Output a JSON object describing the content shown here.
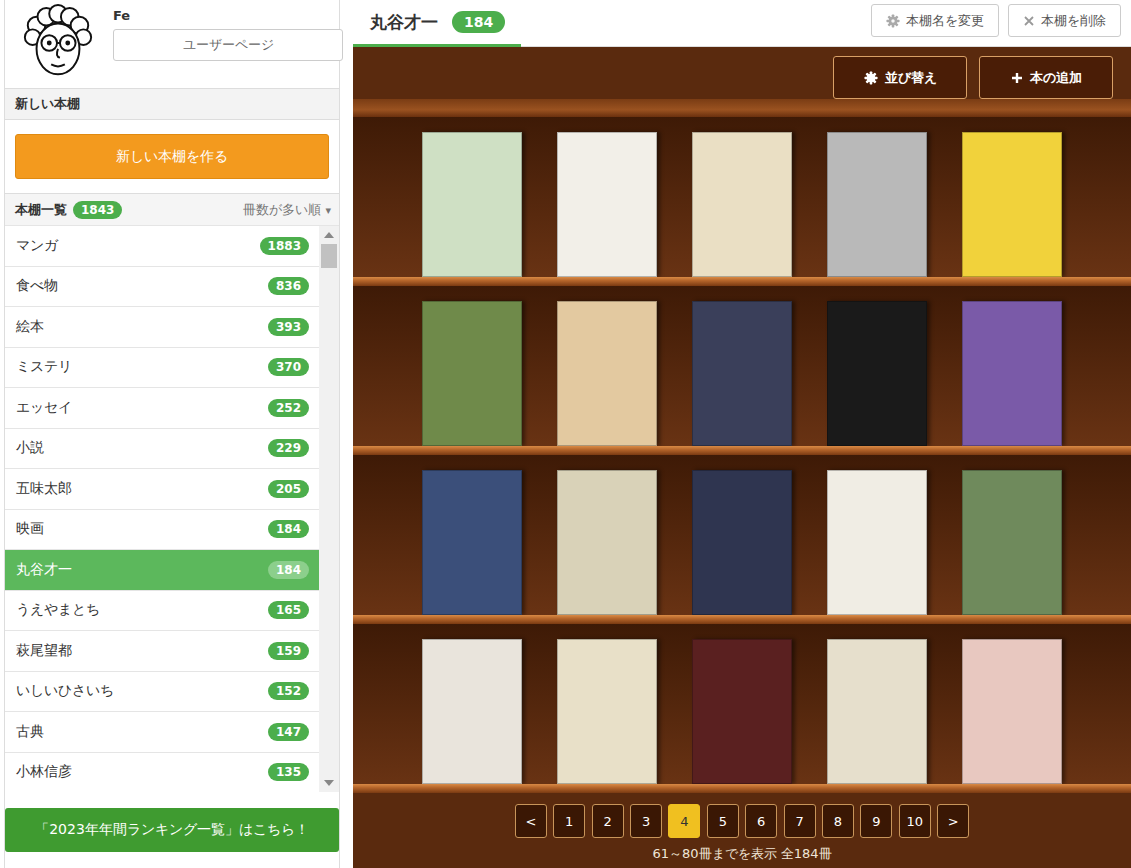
{
  "user": {
    "name": "Fe",
    "page_button": "ユーザーページ"
  },
  "new_shelf": {
    "heading": "新しい本棚",
    "button": "新しい本棚を作る"
  },
  "shelf_list": {
    "heading": "本棚一覧",
    "count": "1843",
    "sort": "冊数が多い順",
    "sort_icon": "▾",
    "items": [
      {
        "name": "マンガ",
        "count": "1883",
        "selected": false
      },
      {
        "name": "食べ物",
        "count": "836",
        "selected": false
      },
      {
        "name": "絵本",
        "count": "393",
        "selected": false
      },
      {
        "name": "ミステリ",
        "count": "370",
        "selected": false
      },
      {
        "name": "エッセイ",
        "count": "252",
        "selected": false
      },
      {
        "name": "小説",
        "count": "229",
        "selected": false
      },
      {
        "name": "五味太郎",
        "count": "205",
        "selected": false
      },
      {
        "name": "映画",
        "count": "184",
        "selected": false
      },
      {
        "name": "丸谷才一",
        "count": "184",
        "selected": true
      },
      {
        "name": "うえやまとち",
        "count": "165",
        "selected": false
      },
      {
        "name": "萩尾望都",
        "count": "159",
        "selected": false
      },
      {
        "name": "いしいひさいち",
        "count": "152",
        "selected": false
      },
      {
        "name": "古典",
        "count": "147",
        "selected": false
      },
      {
        "name": "小林信彦",
        "count": "135",
        "selected": false
      }
    ]
  },
  "banner": "「2023年年間ランキング一覧」はこちら！",
  "shelf": {
    "title": "丸谷才一",
    "count": "184",
    "rename_button": "本棚名を変更",
    "delete_button": "本棚を削除",
    "sort_button": "並び替え",
    "add_button": "本の追加",
    "books": [
      {
        "color": "#cfe0c4"
      },
      {
        "color": "#f2efe8"
      },
      {
        "color": "#eadfc4"
      },
      {
        "color": "#b9b9b9"
      },
      {
        "color": "#f1d23b"
      },
      {
        "color": "#6f8a4a"
      },
      {
        "color": "#e3c9a0"
      },
      {
        "color": "#3a3f5a"
      },
      {
        "color": "#1a1a1a"
      },
      {
        "color": "#7a5aa8"
      },
      {
        "color": "#3b4f7a"
      },
      {
        "color": "#d9d2b8"
      },
      {
        "color": "#2f3550"
      },
      {
        "color": "#f0ede4"
      },
      {
        "color": "#6f8a5c"
      },
      {
        "color": "#e9e4dc"
      },
      {
        "color": "#e8e0c8"
      },
      {
        "color": "#5a2020"
      },
      {
        "color": "#e6dfcc"
      },
      {
        "color": "#e8c8c0"
      }
    ]
  },
  "pagination": {
    "prev": "<",
    "next": ">",
    "pages": [
      {
        "label": "1",
        "selected": false
      },
      {
        "label": "2",
        "selected": false
      },
      {
        "label": "3",
        "selected": false
      },
      {
        "label": "4",
        "selected": true
      },
      {
        "label": "5",
        "selected": false
      },
      {
        "label": "6",
        "selected": false
      },
      {
        "label": "7",
        "selected": false
      },
      {
        "label": "8",
        "selected": false
      },
      {
        "label": "9",
        "selected": false
      },
      {
        "label": "10",
        "selected": false
      }
    ],
    "summary": "61～80冊までを表示 全184冊"
  }
}
